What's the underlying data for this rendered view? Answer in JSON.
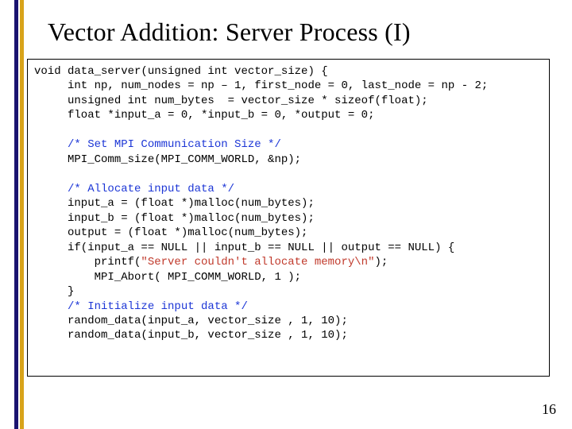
{
  "title": "Vector Addition: Server Process (I)",
  "code": {
    "l01": "void data_server(unsigned int vector_size) {",
    "l02": "     int np, num_nodes = np – 1, first_node = 0, last_node = np - 2;",
    "l03": "     unsigned int num_bytes  = vector_size * sizeof(float);",
    "l04": "     float *input_a = 0, *input_b = 0, *output = 0;",
    "l05": "",
    "l06": "     /* Set MPI Communication Size */",
    "l07": "     MPI_Comm_size(MPI_COMM_WORLD, &np);",
    "l08": "",
    "l09": "     /* Allocate input data */",
    "l10": "     input_a = (float *)malloc(num_bytes);",
    "l11": "     input_b = (float *)malloc(num_bytes);",
    "l12": "     output = (float *)malloc(num_bytes);",
    "l13": "     if(input_a == NULL || input_b == NULL || output == NULL) {",
    "l14a": "         printf(",
    "l14b": "\"Server couldn't allocate memory\\n\"",
    "l14c": ");",
    "l15": "         MPI_Abort( MPI_COMM_WORLD, 1 );",
    "l16": "     }",
    "l17": "     /* Initialize input data */",
    "l18": "     random_data(input_a, vector_size , 1, 10);",
    "l19": "     random_data(input_b, vector_size , 1, 10);"
  },
  "page_number": "16"
}
